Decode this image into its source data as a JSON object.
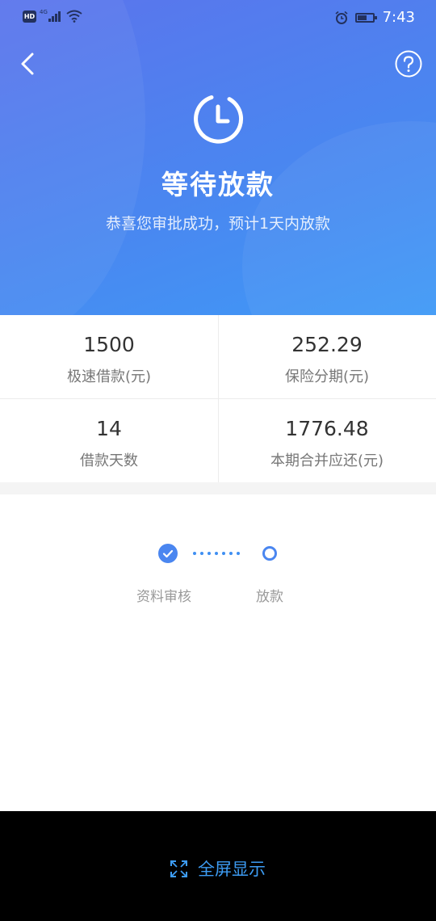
{
  "status_bar": {
    "hd": "HD",
    "network": "4G",
    "battery_level": 0.6,
    "time": "7:43"
  },
  "header": {
    "title": "等待放款",
    "subtitle": "恭喜您审批成功，预计1天内放款",
    "icons": [
      "back-arrow-icon",
      "help-icon",
      "clock-icon"
    ]
  },
  "summary": [
    {
      "value": "1500",
      "label": "极速借款(元)"
    },
    {
      "value": "252.29",
      "label": "保险分期(元)"
    },
    {
      "value": "14",
      "label": "借款天数"
    },
    {
      "value": "1776.48",
      "label": "本期合并应还(元)"
    }
  ],
  "progress": {
    "steps": [
      {
        "label": "资料审核",
        "status": "done"
      },
      {
        "label": "放款",
        "status": "pending"
      }
    ]
  },
  "bottom_bar": {
    "fullscreen_label": "全屏显示",
    "icon": "expand-icon"
  },
  "colors": {
    "header_start": "#5b74ec",
    "header_end": "#3f99f6",
    "accent": "#4a86f0",
    "fullscreen_text": "#3d9cf3"
  }
}
